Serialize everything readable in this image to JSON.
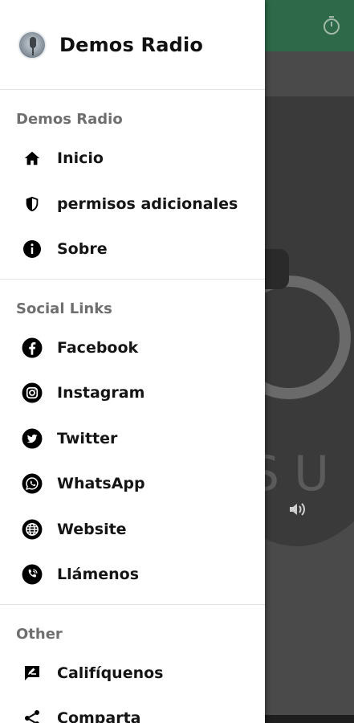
{
  "header": {
    "app_name": "Demos Radio"
  },
  "sections": [
    {
      "title": "Demos Radio",
      "items": [
        {
          "label": "Inicio",
          "icon": "home-icon"
        },
        {
          "label": "permisos adicionales",
          "icon": "shield-icon"
        },
        {
          "label": "Sobre",
          "icon": "info-icon"
        }
      ]
    },
    {
      "title": "Social Links",
      "items": [
        {
          "label": "Facebook",
          "icon": "facebook-icon"
        },
        {
          "label": "Instagram",
          "icon": "instagram-icon"
        },
        {
          "label": "Twitter",
          "icon": "twitter-icon"
        },
        {
          "label": "WhatsApp",
          "icon": "whatsapp-icon"
        },
        {
          "label": "Website",
          "icon": "globe-icon"
        },
        {
          "label": "Llámenos",
          "icon": "phone-icon"
        }
      ]
    },
    {
      "title": "Other",
      "items": [
        {
          "label": "Califíquenos",
          "icon": "rate-icon"
        },
        {
          "label": "Comparta",
          "icon": "share-icon"
        }
      ]
    }
  ],
  "background": {
    "art_text": "SU",
    "top_bar_color": "#2e6a4a"
  }
}
